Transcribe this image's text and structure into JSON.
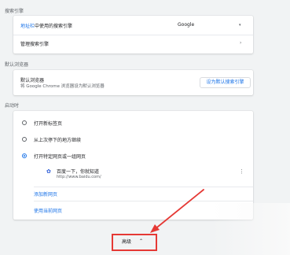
{
  "search_engine": {
    "section_title": "搜索引擎",
    "used_engine_prefix": "地址栏",
    "used_engine_rest": "中使用的搜索引擎",
    "selected_engine": "Google",
    "manage_label": "管理搜索引擎"
  },
  "default_browser": {
    "section_title": "默认浏览器",
    "title": "默认浏览器",
    "subtitle": "将 Google Chrome 浏览器设为默认浏览器",
    "button_label": "设为默认搜索引擎"
  },
  "startup": {
    "section_title": "启动时",
    "options": [
      {
        "label": "打开新标签页",
        "checked": false
      },
      {
        "label": "从上次停下的地方继续",
        "checked": false
      },
      {
        "label": "打开特定网页或一组网页",
        "checked": true
      }
    ],
    "page": {
      "title": "百度一下，你就知道",
      "url": "http://www.baidu.com/"
    },
    "add_page": "添加新网页",
    "use_current": "使用当前网页"
  },
  "advanced": {
    "label": "高级",
    "accent": "#e53935"
  }
}
